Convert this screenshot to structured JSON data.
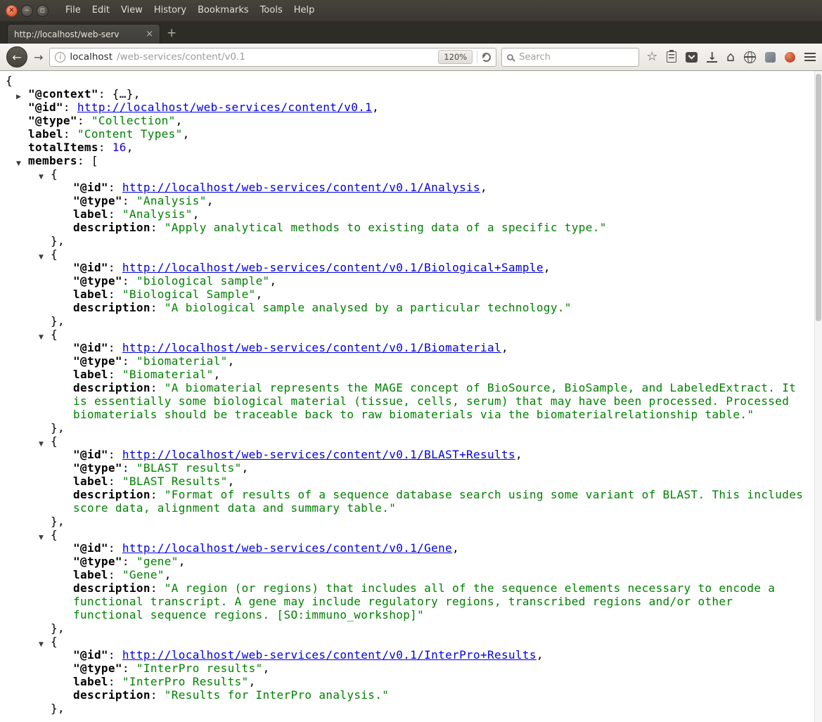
{
  "window": {
    "menu": [
      "File",
      "Edit",
      "View",
      "History",
      "Bookmarks",
      "Tools",
      "Help"
    ],
    "controls": {
      "close": "×",
      "minimize": "−",
      "maximize": "◻"
    }
  },
  "tabs": {
    "active_title": "http://localhost/web-serv",
    "close_glyph": "×",
    "new_tab_glyph": "+"
  },
  "navbar": {
    "back_glyph": "←",
    "forward_glyph": "→",
    "info_glyph": "i",
    "url_host": "localhost",
    "url_path": "/web-services/content/v0.1",
    "zoom_level": "120%",
    "search_placeholder": "Search"
  },
  "colors": {
    "string_green": "#008000",
    "number_blue": "#1a01cc",
    "link_blue": "#0000e0",
    "chrome_dark": "#3b3834",
    "toolbar_light": "#f2efec"
  },
  "json_view": {
    "glyphs": {
      "expanded": "▼",
      "collapsed": "▶"
    },
    "punct": {
      "open_obj": "{",
      "colon": ": ",
      "comma": ",",
      "obj_ellipsis": "{…},",
      "open_arr": "[",
      "close_obj_comma": "},",
      "quote": "\""
    },
    "keys": {
      "context": "\"@context\"",
      "id": "\"@id\"",
      "type": "\"@type\"",
      "label": "label",
      "totalItems": "totalItems",
      "members": "members",
      "description": "description"
    },
    "root": {
      "id_url": "http://localhost/web-services/content/v0.1",
      "type": "Collection",
      "label": "Content Types",
      "totalItems": "16"
    },
    "members": [
      {
        "id_url": "http://localhost/web-services/content/v0.1/Analysis",
        "type": "Analysis",
        "label": "Analysis",
        "description": "Apply analytical methods to existing data of a specific type."
      },
      {
        "id_url": "http://localhost/web-services/content/v0.1/Biological+Sample",
        "type": "biological sample",
        "label": "Biological Sample",
        "description": "A biological sample analysed by a particular technology."
      },
      {
        "id_url": "http://localhost/web-services/content/v0.1/Biomaterial",
        "type": "biomaterial",
        "label": "Biomaterial",
        "description": "A biomaterial represents the MAGE concept of BioSource, BioSample, and LabeledExtract. It is essentially some biological material (tissue, cells, serum) that may have been processed. Processed biomaterials should be traceable back to raw biomaterials via the biomaterialrelationship table."
      },
      {
        "id_url": "http://localhost/web-services/content/v0.1/BLAST+Results",
        "type": "BLAST results",
        "label": "BLAST Results",
        "description": "Format of results of a sequence database search using some variant of BLAST. This includes score data, alignment data and summary table."
      },
      {
        "id_url": "http://localhost/web-services/content/v0.1/Gene",
        "type": "gene",
        "label": "Gene",
        "description": "A region (or regions) that includes all of the sequence elements necessary to encode a functional transcript. A gene may include regulatory regions, transcribed regions and/or other functional sequence regions. [SO:immuno_workshop]"
      },
      {
        "id_url": "http://localhost/web-services/content/v0.1/InterPro+Results",
        "type": "InterPro results",
        "label": "InterPro Results",
        "description": "Results for InterPro analysis."
      }
    ]
  }
}
